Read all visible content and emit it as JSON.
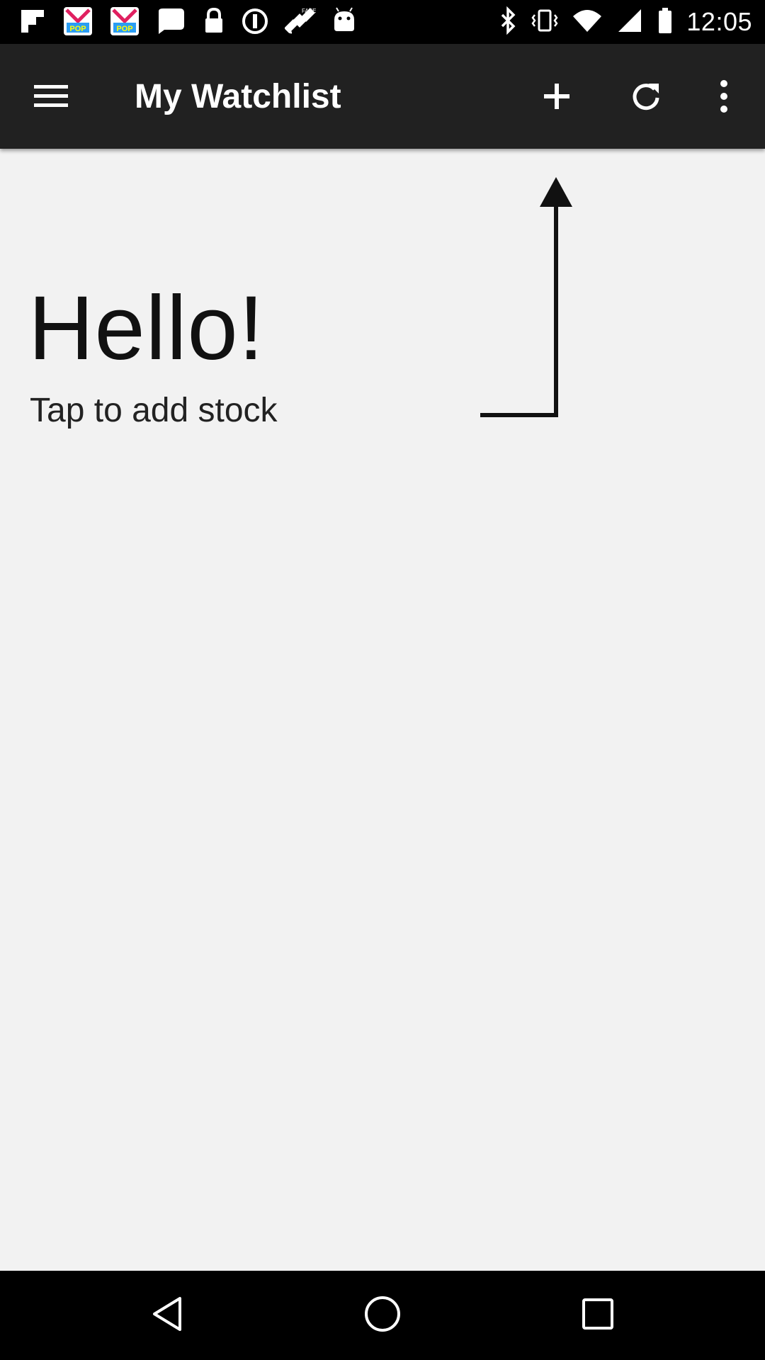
{
  "status_bar": {
    "time": "12:05",
    "left_icons": [
      "flipboard-icon",
      "pop-app-icon",
      "pop-app-icon",
      "chat-bubble-icon",
      "lock-icon",
      "alert-circle-icon",
      "satellite-icon",
      "android-icon"
    ],
    "right_icons": [
      "bluetooth-icon",
      "vibrate-icon",
      "wifi-icon",
      "signal-icon",
      "battery-icon"
    ]
  },
  "app_bar": {
    "title": "My Watchlist",
    "actions": [
      "add-icon",
      "refresh-icon",
      "more-vert-icon"
    ],
    "background": "#212121"
  },
  "content": {
    "greeting": "Hello!",
    "hint": "Tap to add stock"
  },
  "nav_bar": {
    "buttons": [
      "back-icon",
      "home-icon",
      "recents-icon"
    ]
  }
}
